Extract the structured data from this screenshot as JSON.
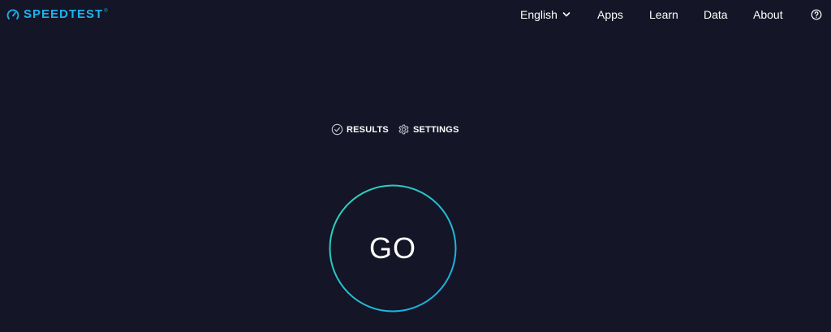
{
  "header": {
    "logo_text": "SPEEDTEST",
    "logo_tm": "®",
    "logo_icon": "speedometer-icon",
    "accent_color": "#1ab3f0",
    "nav": {
      "language": "English",
      "apps": "Apps",
      "learn": "Learn",
      "data": "Data",
      "about": "About"
    },
    "help_icon": "question-circle-icon"
  },
  "tabs": {
    "results": {
      "label": "RESULTS",
      "icon": "check-circle-icon"
    },
    "settings": {
      "label": "SETTINGS",
      "icon": "gear-icon"
    }
  },
  "go_button": {
    "label": "GO",
    "ring_color_start": "#2ed8b8",
    "ring_color_end": "#1aa8e8"
  },
  "colors": {
    "background": "#141526",
    "text": "#ffffff"
  }
}
